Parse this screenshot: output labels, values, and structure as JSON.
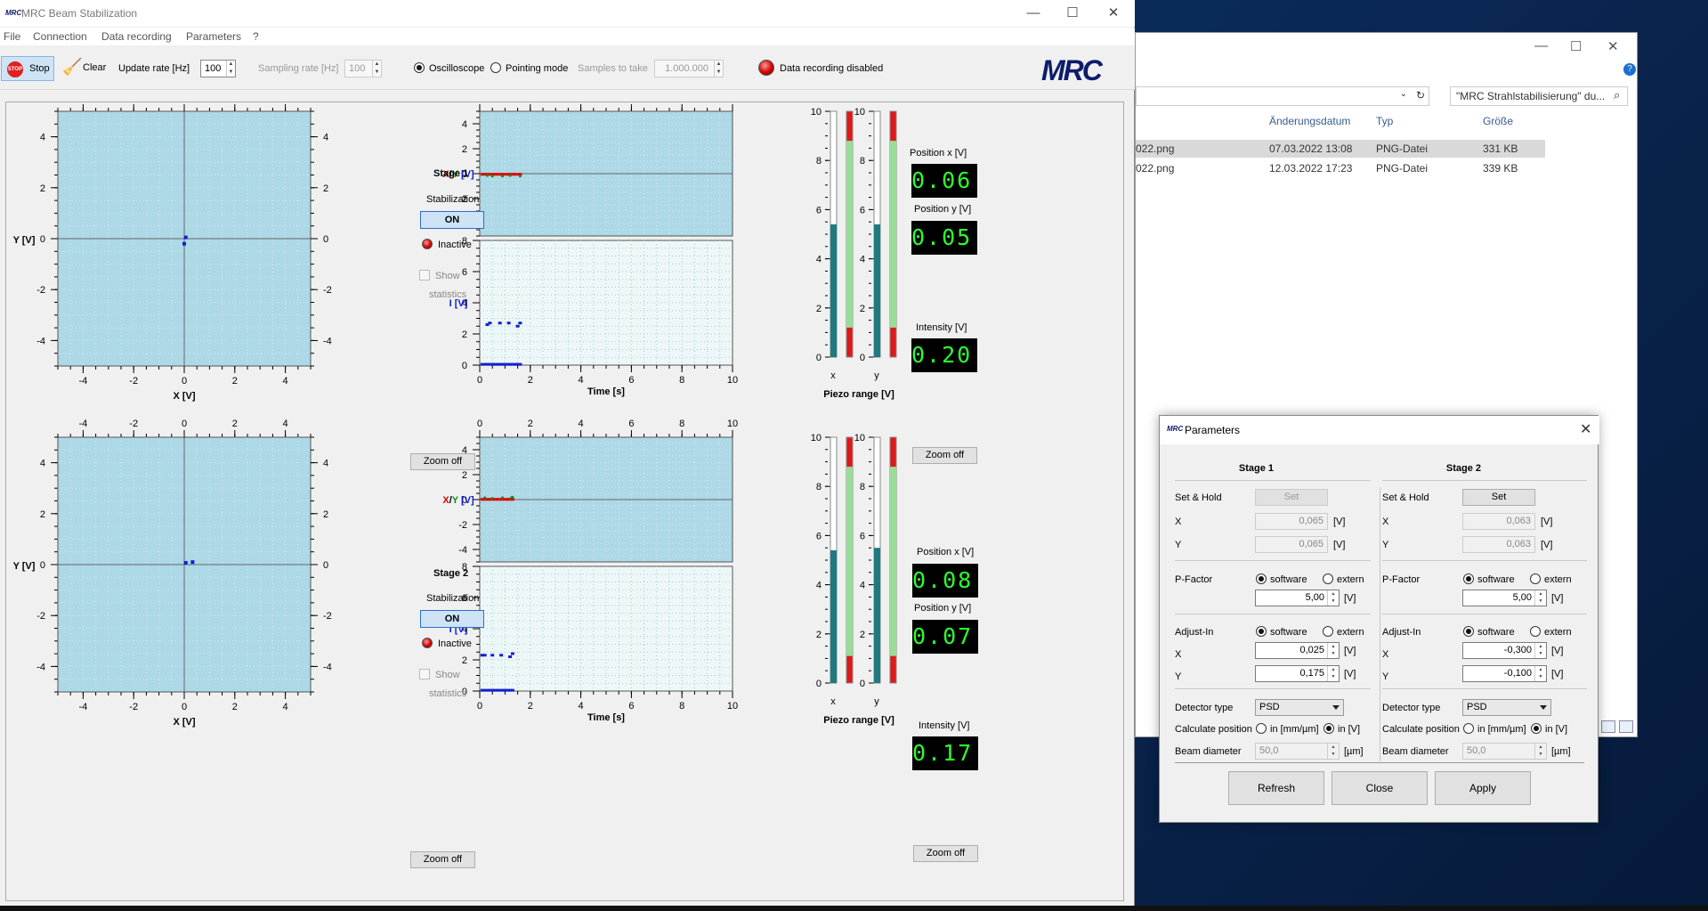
{
  "app": {
    "title": "MRC Beam Stabilization",
    "logo_small": "MRC",
    "logo": "MRC",
    "menu": [
      "File",
      "Connection",
      "Data recording",
      "Parameters",
      "?"
    ]
  },
  "toolbar": {
    "stop_icon_text": "STOP",
    "stop_label": "Stop",
    "clear_label": "Clear",
    "update_rate_label": "Update rate [Hz]",
    "update_rate_value": "100",
    "sampling_rate_label": "Sampling rate [Hz]",
    "sampling_rate_value": "100",
    "mode_oscilloscope": "Oscilloscope",
    "mode_pointing": "Pointing mode",
    "mode_selected": "Oscilloscope",
    "samples_label": "Samples to take",
    "samples_value": "1.000.000",
    "recording_status": "Data recording disabled"
  },
  "colors": {
    "plot_bg": "#add8e6",
    "intensity_bg": "#eef7f8",
    "position_x": "#e00000",
    "position_y": "#1a8a1a",
    "intensity": "#1020d0",
    "piezo_x_fill": "#1f7a80",
    "piezo_y_fill": "#1f7a80",
    "piezo_range_red": "#e01818",
    "piezo_range_green": "#99dd99"
  },
  "stages": [
    {
      "title": "Stage 1",
      "stabilization_label": "Stabilization",
      "stabilization_state": "ON",
      "status": "Inactive",
      "show_statistics_1": "Show",
      "show_statistics_2": "statistics",
      "zoom_xy": "Zoom off",
      "zoom_time": "Zoom off",
      "xy_xlabel": "X [V]",
      "xy_ylabel": "Y [V]",
      "pos_ylabel_x": "X",
      "pos_ylabel_slash": "/",
      "pos_ylabel_y": "Y",
      "pos_ylabel_unit": " [V]",
      "int_ylabel": "I [V]",
      "time_label": "Time [s]",
      "position_x_label": "Position x [V]",
      "position_x_value": "0.06",
      "position_y_label": "Position y [V]",
      "position_y_value": "0.05",
      "intensity_label": "Intensity [V]",
      "intensity_value": "0.20",
      "piezo_x_label": "x",
      "piezo_y_label": "y",
      "piezo_title": "Piezo range [V]",
      "piezo_x_level": 5.4,
      "piezo_y_level": 5.4,
      "piezo_x_range": [
        1.2,
        8.8
      ],
      "piezo_y_range": [
        1.2,
        8.8
      ]
    },
    {
      "title": "Stage 2",
      "stabilization_label": "Stabilization",
      "stabilization_state": "ON",
      "status": "Inactive",
      "show_statistics_1": "Show",
      "show_statistics_2": "statistics",
      "zoom_xy": "Zoom off",
      "zoom_time": "Zoom off",
      "xy_xlabel": "X [V]",
      "xy_ylabel": "Y [V]",
      "pos_ylabel_x": "X",
      "pos_ylabel_slash": "/",
      "pos_ylabel_y": "Y",
      "pos_ylabel_unit": " [V]",
      "int_ylabel": "I [V]",
      "time_label": "Time [s]",
      "position_x_label": "Position x [V]",
      "position_x_value": "0.08",
      "position_y_label": "Position y [V]",
      "position_y_value": "0.07",
      "intensity_label": "Intensity [V]",
      "intensity_value": "0.17",
      "piezo_x_label": "x",
      "piezo_y_label": "y",
      "piezo_title": "Piezo range [V]",
      "piezo_x_level": 5.4,
      "piezo_y_level": 5.5,
      "piezo_x_range": [
        1.1,
        8.8
      ],
      "piezo_y_range": [
        1.1,
        8.8
      ]
    }
  ],
  "chart_data": [
    {
      "type": "scatter",
      "name_ref": "stage1-xy",
      "xlim": [
        -5,
        5
      ],
      "ylim": [
        -5,
        5
      ],
      "xticks": [
        "-4",
        "-2",
        "0",
        "2",
        "4"
      ],
      "yticks": [
        "4",
        "2",
        "0",
        "-2",
        "-4"
      ],
      "x": [
        0.0,
        0.06
      ],
      "y": [
        -0.2,
        0.05
      ]
    },
    {
      "type": "scatter",
      "name_ref": "stage2-xy",
      "xlim": [
        -5,
        5
      ],
      "ylim": [
        -5,
        5
      ],
      "xticks": [
        "-4",
        "-2",
        "0",
        "2",
        "4"
      ],
      "yticks": [
        "4",
        "2",
        "0",
        "-2",
        "-4"
      ],
      "x": [
        0.06,
        0.33
      ],
      "y": [
        0.07,
        0.1
      ]
    },
    {
      "type": "scatter",
      "name_ref": "stage1-position",
      "xlim": [
        0,
        10
      ],
      "ylim": [
        -5,
        5
      ],
      "xticks": [
        "0",
        "2",
        "4",
        "6",
        "8",
        "10"
      ],
      "yticks": [
        "4",
        "2",
        "0",
        "-2",
        "-4"
      ],
      "series": [
        {
          "name": "x",
          "x": [
            0.1,
            0.2,
            0.3,
            0.4,
            0.5,
            0.6,
            0.7,
            0.8,
            0.9,
            1.0,
            1.1,
            1.2,
            1.3,
            1.4,
            1.5,
            1.6
          ],
          "values": [
            -0.05,
            -0.05,
            -0.05,
            -0.05,
            -0.05,
            -0.05,
            -0.05,
            -0.05,
            -0.05,
            -0.05,
            -0.05,
            -0.05,
            -0.05,
            -0.05,
            -0.05,
            -0.05
          ]
        },
        {
          "name": "y",
          "x": [
            0.3,
            0.5,
            0.9,
            1.2,
            1.6
          ],
          "values": [
            -0.15,
            -0.2,
            -0.2,
            -0.15,
            -0.2
          ]
        }
      ]
    },
    {
      "type": "scatter",
      "name_ref": "stage1-intensity",
      "xlim": [
        0,
        10
      ],
      "ylim": [
        0,
        8
      ],
      "xticks": [
        "0",
        "2",
        "4",
        "6",
        "8",
        "10"
      ],
      "yticks": [
        "8",
        "6",
        "4",
        "2",
        "0"
      ],
      "series": [
        {
          "name": "I-high",
          "x": [
            0.3,
            0.4,
            0.8,
            1.15,
            1.5,
            1.6
          ],
          "values": [
            2.6,
            2.7,
            2.7,
            2.7,
            2.5,
            2.7
          ]
        },
        {
          "name": "I-low",
          "x": [
            0.1,
            0.2,
            0.3,
            0.4,
            0.5,
            0.6,
            0.7,
            0.8,
            0.9,
            1.0,
            1.1,
            1.2,
            1.3,
            1.4,
            1.5,
            1.6
          ],
          "values": [
            0.05,
            0.05,
            0.05,
            0.05,
            0.05,
            0.05,
            0.05,
            0.05,
            0.05,
            0.05,
            0.05,
            0.05,
            0.05,
            0.05,
            0.05,
            0.05
          ]
        }
      ]
    },
    {
      "type": "scatter",
      "name_ref": "stage2-position",
      "xlim": [
        0,
        10
      ],
      "ylim": [
        -5,
        5
      ],
      "xticks": [
        "0",
        "2",
        "4",
        "6",
        "8",
        "10"
      ],
      "yticks": [
        "4",
        "2",
        "0",
        "-2",
        "-4"
      ],
      "series": [
        {
          "name": "x",
          "x": [
            0.1,
            0.2,
            0.3,
            0.4,
            0.5,
            0.6,
            0.7,
            0.8,
            0.9,
            1.0,
            1.1,
            1.2,
            1.3
          ],
          "values": [
            0.02,
            0.02,
            0.02,
            0.02,
            0.02,
            0.02,
            0.02,
            0.02,
            0.02,
            0.02,
            0.02,
            0.02,
            0.02
          ]
        },
        {
          "name": "y",
          "x": [
            0.2,
            0.5,
            0.9,
            1.25,
            1.3
          ],
          "values": [
            0.15,
            0.1,
            0.15,
            0.15,
            0.2
          ]
        }
      ]
    },
    {
      "type": "scatter",
      "name_ref": "stage2-intensity",
      "xlim": [
        0,
        10
      ],
      "ylim": [
        0,
        8
      ],
      "xticks": [
        "0",
        "2",
        "4",
        "6",
        "8",
        "10"
      ],
      "yticks": [
        "8",
        "6",
        "4",
        "2",
        "0"
      ],
      "series": [
        {
          "name": "I-high",
          "x": [
            0.1,
            0.2,
            0.5,
            0.85,
            1.2,
            1.3
          ],
          "values": [
            2.3,
            2.3,
            2.3,
            2.3,
            2.2,
            2.4
          ]
        },
        {
          "name": "I-low",
          "x": [
            0.1,
            0.2,
            0.3,
            0.4,
            0.5,
            0.6,
            0.7,
            0.8,
            0.9,
            1.0,
            1.1,
            1.2,
            1.3
          ],
          "values": [
            0.05,
            0.05,
            0.05,
            0.05,
            0.05,
            0.05,
            0.05,
            0.05,
            0.05,
            0.05,
            0.05,
            0.05,
            0.05
          ]
        }
      ]
    }
  ],
  "piezo_ticks": [
    "10",
    "8",
    "6",
    "4",
    "2",
    "0"
  ],
  "explorer": {
    "search_text": "\"MRC Strahlstabilisierung\" du...",
    "help": "?",
    "columns": [
      "Änderungsdatum",
      "Typ",
      "Größe"
    ],
    "rows": [
      {
        "name": "022.png",
        "date": "07.03.2022 13:08",
        "type": "PNG-Datei",
        "size": "331 KB"
      },
      {
        "name": "022.png",
        "date": "12.03.2022 17:23",
        "type": "PNG-Datei",
        "size": "339 KB"
      }
    ]
  },
  "dialog": {
    "title": "Parameters",
    "logo": "MRC",
    "close_label": "Close",
    "refresh_label": "Refresh",
    "apply_label": "Apply",
    "stages": [
      {
        "header": "Stage 1",
        "set_hold": "Set & Hold",
        "set_label": "Set",
        "x_label": "X",
        "y_label": "Y",
        "set_x": "0,065",
        "set_y": "0,065",
        "unit_v": "[V]",
        "pfactor_label": "P-Factor",
        "software": "software",
        "extern": "extern",
        "pfactor_mode": "software",
        "pfactor": "5,00",
        "adjust_label": "Adjust-In",
        "adjust_mode": "software",
        "adjust_x": "0,025",
        "adjust_y": "0,175",
        "detector_label": "Detector type",
        "detector": "PSD",
        "calc_label": "Calculate position",
        "calc_mm": "in [mm/µm]",
        "calc_v": "in [V]",
        "beam_label": "Beam diameter",
        "beam": "50,0",
        "unit_um": "[µm]"
      },
      {
        "header": "Stage 2",
        "set_hold": "Set & Hold",
        "set_label": "Set",
        "x_label": "X",
        "y_label": "Y",
        "set_x": "0,063",
        "set_y": "0,063",
        "unit_v": "[V]",
        "pfactor_label": "P-Factor",
        "software": "software",
        "extern": "extern",
        "pfactor_mode": "software",
        "pfactor": "5,00",
        "adjust_label": "Adjust-In",
        "adjust_mode": "software",
        "adjust_x": "-0,300",
        "adjust_y": "-0,100",
        "detector_label": "Detector type",
        "detector": "PSD",
        "calc_label": "Calculate position",
        "calc_mm": "in [mm/µm]",
        "calc_v": "in [V]",
        "beam_label": "Beam diameter",
        "beam": "50,0",
        "unit_um": "[µm]"
      }
    ]
  }
}
